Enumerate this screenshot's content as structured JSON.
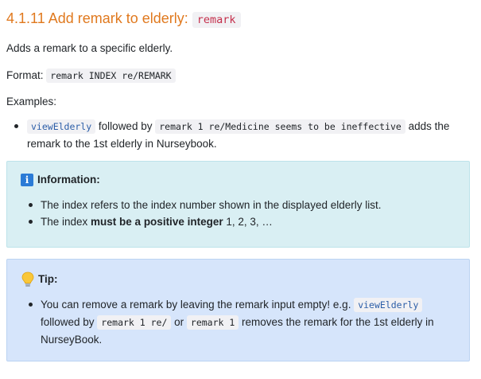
{
  "section": {
    "title_text": "4.1.11 Add remark to elderly: ",
    "title_code": "remark"
  },
  "description": "Adds a remark to a specific elderly.",
  "format": {
    "label": "Format: ",
    "code": "remark INDEX re/REMARK"
  },
  "examples": {
    "label": "Examples:",
    "items": [
      {
        "code1": "viewElderly",
        "text1": " followed by ",
        "code2": "remark 1 re/Medicine seems to be ineffective",
        "text2": " adds the remark to the 1st elderly in Nurseybook."
      }
    ]
  },
  "info_box": {
    "icon": "info-icon",
    "heading": "Information:",
    "items": [
      {
        "text": "The index refers to the index number shown in the displayed elderly list."
      },
      {
        "text_before": "The index ",
        "bold": "must be a positive integer",
        "text_after": " 1, 2, 3, …"
      }
    ]
  },
  "tip_box": {
    "icon": "lightbulb-icon",
    "heading": "Tip:",
    "item": {
      "text1": "You can remove a remark by leaving the remark input empty! e.g. ",
      "code1": "viewElderly",
      "text2": " followed by ",
      "code2": "remark 1 re/",
      "text3": " or ",
      "code3": "remark 1",
      "text4": " removes the remark for the 1st elderly in NurseyBook."
    }
  },
  "colors": {
    "heading": "#e0791e",
    "code_red": "#c5304c",
    "code_blue": "#2c5ea8",
    "info_bg": "#d9eff3",
    "tip_bg": "#d6e5fb"
  }
}
